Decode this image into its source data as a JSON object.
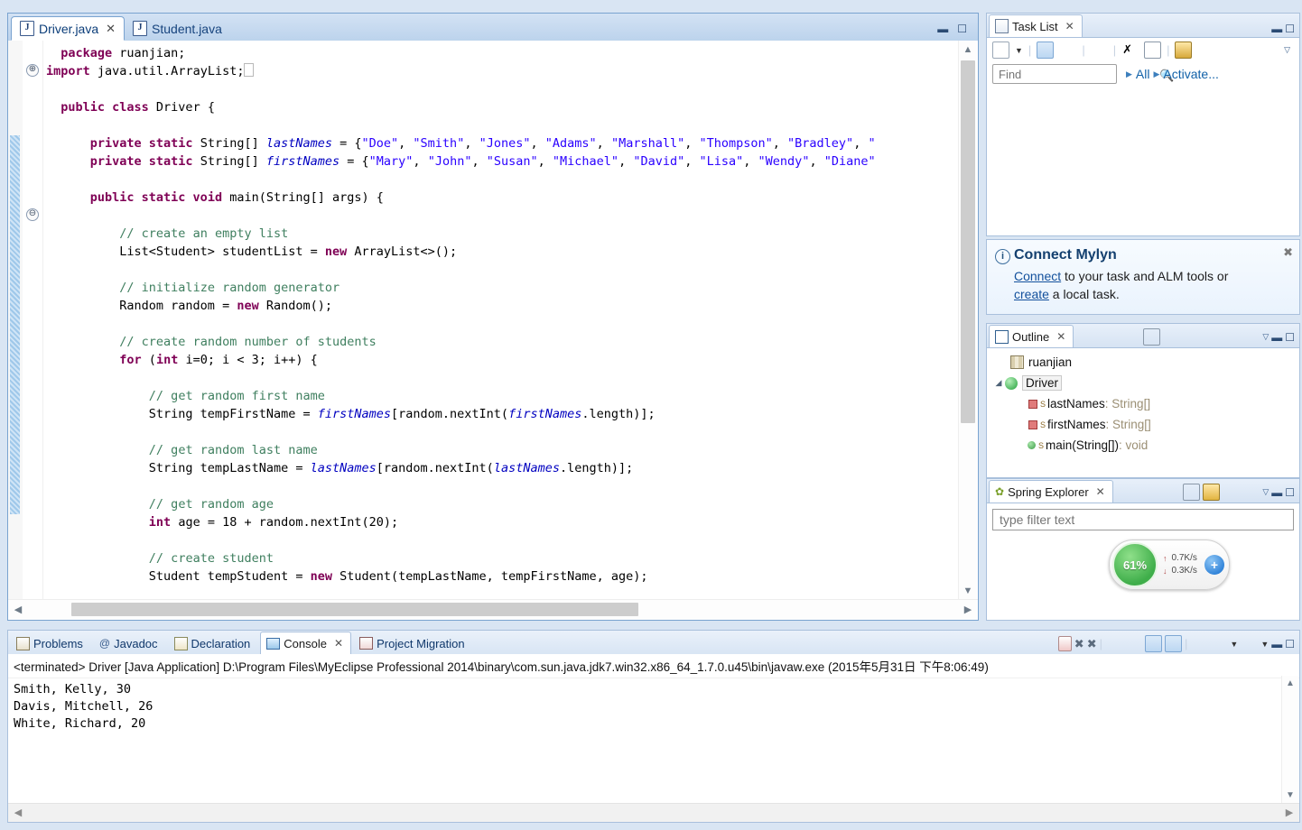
{
  "editor": {
    "tabs": [
      {
        "label": "Driver.java",
        "icon": "java-file-icon",
        "active": true,
        "closable": true
      },
      {
        "label": "Student.java",
        "icon": "java-file-icon",
        "active": false,
        "closable": false
      }
    ],
    "window_buttons": {
      "minimize": "—",
      "maximize": "□"
    },
    "code_lines": [
      "package ruanjian;",
      "import java.util.ArrayList;",
      "public class Driver {",
      "private static String[] lastNames = {\"Doe\", \"Smith\", \"Jones\", \"Adams\", \"Marshall\", \"Thompson\", \"Bradley\", \"",
      "private static String[] firstNames = {\"Mary\", \"John\", \"Susan\", \"Michael\", \"David\", \"Lisa\", \"Wendy\", \"Diane\"",
      "public static void main(String[] args) {",
      "// create an empty list",
      "List<Student> studentList = new ArrayList<>();",
      "// initialize random generator",
      "Random random = new Random();",
      "// create random number of students",
      "for (int i=0; i < 3; i++) {",
      "// get random first name",
      "String tempFirstName = firstNames[random.nextInt(firstNames.length)];",
      "// get random last name",
      "String tempLastName = lastNames[random.nextInt(lastNames.length)];",
      "// get random age",
      "int age = 18 + random.nextInt(20);",
      "// create student",
      "Student tempStudent = new Student(tempLastName, tempFirstName, age);"
    ]
  },
  "task_list": {
    "tab_label": "Task List",
    "find": {
      "value": "",
      "placeholder": "Find"
    },
    "breadcrumbs": [
      "All",
      "Activate..."
    ],
    "toolbar": [
      "new-task-icon",
      "dropdown-arrow-icon",
      "categorized-presentation-icon",
      "scheduled-presentation-icon",
      "focus-on-workweek-icon",
      "collapse-all-icon",
      "restore-icon",
      "synchronize-icon",
      "view-menu-icon"
    ]
  },
  "mylyn": {
    "title": "Connect Mylyn",
    "link_connect": "Connect",
    "text_middle": " to your task and ALM tools or ",
    "link_create": "create",
    "text_end": " a local task.",
    "close": "✖"
  },
  "outline": {
    "tab_label": "Outline",
    "toolbar": [
      "focus-icon",
      "collapse-all-icon",
      "sort-icon",
      "hide-fields-icon",
      "hide-static-icon",
      "hide-nonpublic-icon",
      "hide-local-types-icon",
      "view-menu-icon",
      "minimize-icon",
      "maximize-icon"
    ],
    "items": [
      {
        "label": "ruanjian",
        "type": "",
        "indent": 1,
        "icon": "package-icon",
        "arrow": false,
        "selected": false
      },
      {
        "label": "Driver",
        "type": "",
        "indent": 0,
        "icon": "class-icon",
        "arrow": true,
        "selected": true
      },
      {
        "label": "lastNames",
        "type": " : String[]",
        "indent": 2,
        "icon": "private-field-icon",
        "arrow": false,
        "static": "S",
        "selected": false
      },
      {
        "label": "firstNames",
        "type": " : String[]",
        "indent": 2,
        "icon": "private-field-icon",
        "arrow": false,
        "static": "S",
        "selected": false
      },
      {
        "label": "main(String[])",
        "type": " : void",
        "indent": 2,
        "icon": "public-method-icon",
        "arrow": false,
        "static": "S",
        "selected": false
      }
    ]
  },
  "spring_explorer": {
    "tab_label": "Spring Explorer",
    "filter": {
      "value": "",
      "placeholder": "type filter text"
    },
    "toolbar": [
      "collapse-all-icon",
      "refresh-icon",
      "link-editor-icon",
      "sort-icon",
      "view-menu-icon",
      "minimize-icon",
      "maximize-icon"
    ]
  },
  "net_widget": {
    "percent": "61%",
    "upload": "0.7K/s",
    "download": "0.3K/s",
    "up_arrow": "↑",
    "down_arrow": "↓",
    "plus": "+",
    "ball_color": "#49b056",
    "badge_color": "#e03a34"
  },
  "console": {
    "tabs": [
      {
        "label": "Problems",
        "icon": "problems-icon",
        "active": false,
        "closable": false
      },
      {
        "label": "Javadoc",
        "icon": "javadoc-icon",
        "active": false,
        "closable": false
      },
      {
        "label": "Declaration",
        "icon": "declaration-icon",
        "active": false,
        "closable": false
      },
      {
        "label": "Console",
        "icon": "console-icon",
        "active": true,
        "closable": true
      },
      {
        "label": "Project Migration",
        "icon": "migration-icon",
        "active": false,
        "closable": false
      }
    ],
    "launch_header": "<terminated> Driver [Java Application] D:\\Program Files\\MyEclipse Professional 2014\\binary\\com.sun.java.jdk7.win32.x86_64_1.7.0.u45\\bin\\javaw.exe (2015年5月31日 下午8:06:49)",
    "output_lines": [
      "Smith, Kelly, 30",
      "Davis, Mitchell, 26",
      "White, Richard, 20"
    ],
    "toolbar": [
      "terminate-icon",
      "remove-launch-icon",
      "remove-all-launches-icon",
      "show-console-icon",
      "scroll-lock-icon",
      "word-wrap-icon",
      "clear-console-icon",
      "pin-console-icon",
      "display-console-icon",
      "dropdown-arrow-icon",
      "new-console-icon",
      "view-menu-icon",
      "minimize-icon",
      "maximize-icon"
    ]
  }
}
